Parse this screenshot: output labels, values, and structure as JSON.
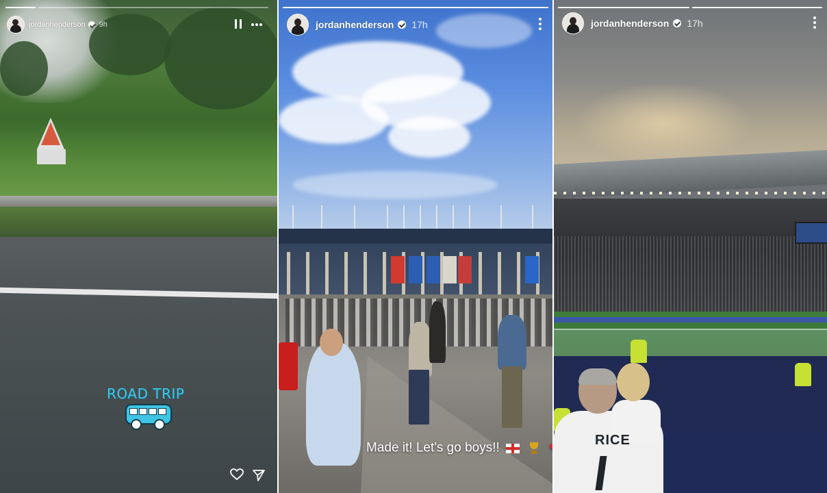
{
  "stories": [
    {
      "username": "jordanhenderson",
      "time": "9h",
      "sticker_text": "ROAD TRIP",
      "progress": [
        1.0,
        0.0,
        0.0,
        0.0,
        0.0,
        0.0,
        0.0,
        0.0
      ],
      "icons": [
        "pause-icon",
        "more-icon",
        "heart-icon",
        "send-icon",
        "van-icon"
      ]
    },
    {
      "username": "jordanhenderson",
      "time": "17h",
      "caption": "Made it! Let's go boys!!",
      "progress": [
        1.0
      ],
      "icons": [
        "more-icon",
        "england-flag-icon",
        "trophy-icon",
        "red-heart-icon"
      ]
    },
    {
      "username": "jordanhenderson",
      "time": "17h",
      "shirt_text": "RICE",
      "progress": [
        1.0,
        1.0
      ],
      "icons": [
        "more-icon"
      ]
    }
  ]
}
